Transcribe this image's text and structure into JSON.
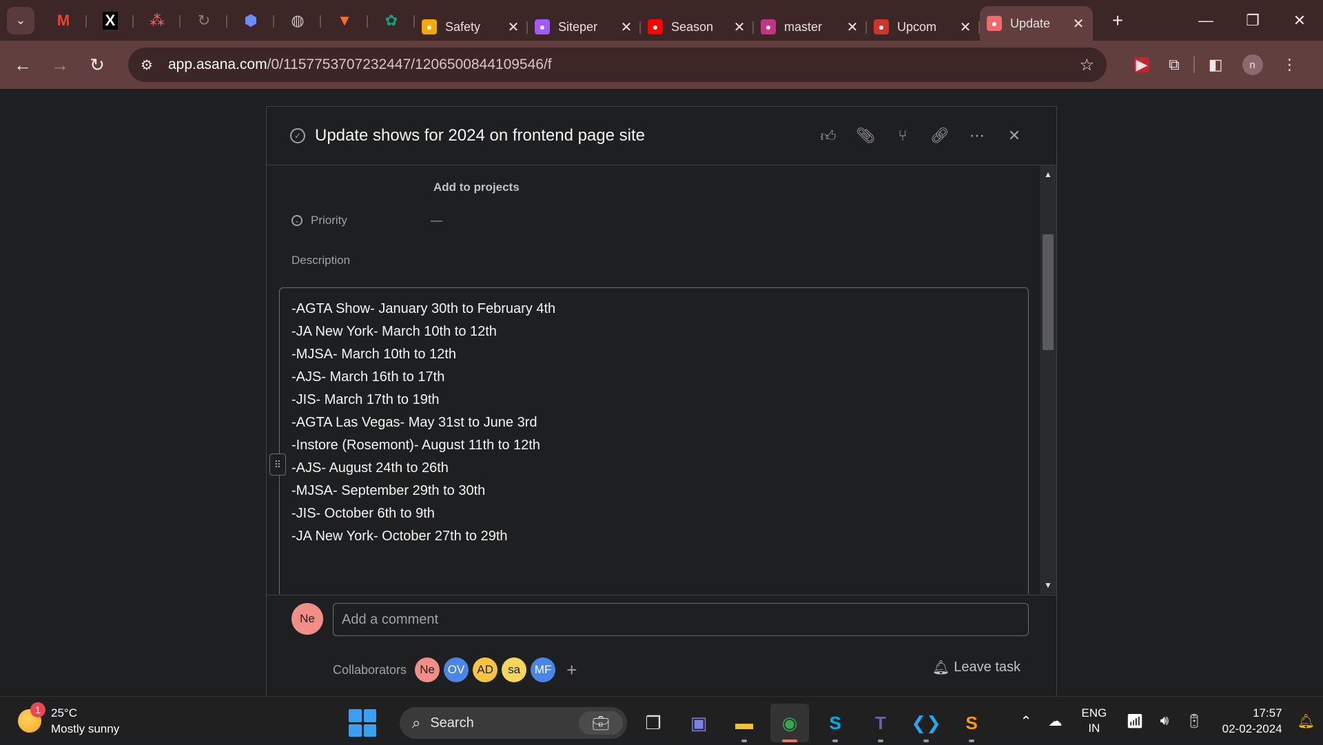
{
  "browser": {
    "tabs": [
      {
        "label": "Safety",
        "icon": "bar-chart-icon",
        "color": "#f2a900"
      },
      {
        "label": "Siteper",
        "icon": "figma-icon",
        "color": "#a259ff"
      },
      {
        "label": "Season",
        "icon": "youtube-icon",
        "color": "#ff0000"
      },
      {
        "label": "master",
        "icon": "instagram-icon",
        "color": "#c13584"
      },
      {
        "label": "Upcom",
        "icon": "ruby-icon",
        "color": "#cc342d"
      },
      {
        "label": "Update",
        "icon": "asana-icon",
        "color": "#f06a6a",
        "active": true
      }
    ],
    "url_host": "app.asana.com",
    "url_path": "/0/1157753707232447/1206500844109546/f",
    "profile_initial": "n"
  },
  "task": {
    "title": "Update shows for 2024 on frontend page site",
    "add_to_projects": "Add to projects",
    "priority_label": "Priority",
    "priority_value": "—",
    "description_label": "Description",
    "description_lines": [
      "-AGTA Show- January 30th to February 4th",
      "-JA New York- March 10th to 12th",
      "-MJSA- March 10th to 12th",
      "-AJS- March 16th to 17th",
      "-JIS- March 17th to 19th",
      "-AGTA Las Vegas- May 31st to June 3rd",
      "-Instore (Rosemont)- August 11th to 12th",
      "-AJS- August 24th to 26th",
      "-MJSA- September 29th to 30th",
      "-JIS- October 6th to 9th",
      "-JA New York- October 27th to 29th"
    ],
    "comment_avatar": "Ne",
    "comment_placeholder": "Add a comment",
    "collaborators_label": "Collaborators",
    "collaborators": [
      {
        "initials": "Ne",
        "bg": "#f18e86",
        "fg": "#1e1f21"
      },
      {
        "initials": "OV",
        "bg": "#4a86e8",
        "fg": "#ffffff"
      },
      {
        "initials": "AD",
        "bg": "#f6c343",
        "fg": "#1e1f21"
      },
      {
        "initials": "sa",
        "bg": "#f6d55c",
        "fg": "#1e1f21"
      },
      {
        "initials": "MF",
        "bg": "#4a86e8",
        "fg": "#ffffff"
      }
    ],
    "leave_task": "Leave task"
  },
  "taskbar": {
    "weather_badge": "1",
    "temperature": "25°C",
    "weather": "Mostly sunny",
    "search": "Search",
    "lang_1": "ENG",
    "lang_2": "IN",
    "time": "17:57",
    "date": "02-02-2024"
  }
}
